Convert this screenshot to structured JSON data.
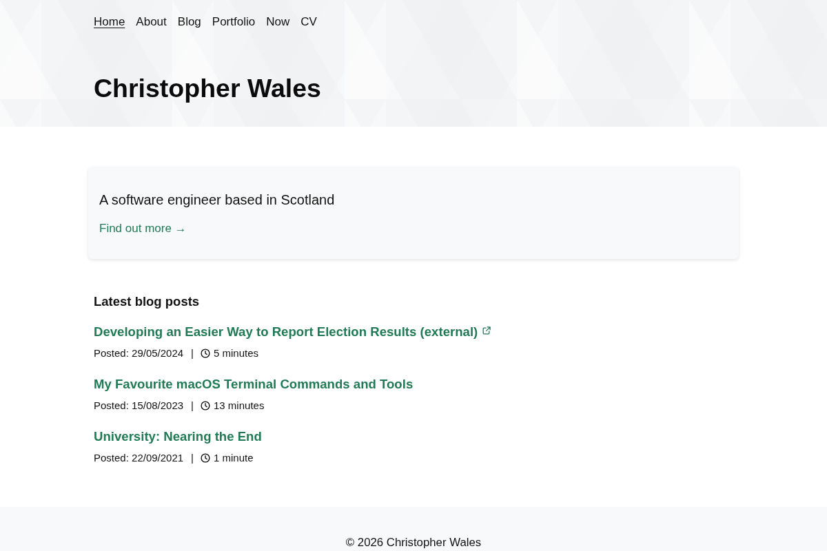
{
  "nav": {
    "items": [
      {
        "label": "Home",
        "selected": true
      },
      {
        "label": "About",
        "selected": false
      },
      {
        "label": "Blog",
        "selected": false
      },
      {
        "label": "Portfolio",
        "selected": false
      },
      {
        "label": "Now",
        "selected": false
      },
      {
        "label": "CV",
        "selected": false
      }
    ]
  },
  "header": {
    "title": "Christopher Wales"
  },
  "intro": {
    "text": "A software engineer based in Scotland",
    "link": "Find out more →"
  },
  "posts_section": {
    "heading": "Latest blog posts",
    "posts": [
      {
        "title": "Developing an Easier Way to Report Election Results (external)",
        "external": true,
        "posted": "Posted: 29/05/2024",
        "separator": "|",
        "read_time": "5 minutes"
      },
      {
        "title": "My Favourite macOS Terminal Commands and Tools",
        "external": false,
        "posted": "Posted: 15/08/2023",
        "separator": "|",
        "read_time": "13 minutes"
      },
      {
        "title": "University: Nearing the End",
        "external": false,
        "posted": "Posted: 22/09/2021",
        "separator": "|",
        "read_time": "1 minute"
      }
    ]
  },
  "footer": {
    "text": "© 2026 Christopher Wales"
  }
}
